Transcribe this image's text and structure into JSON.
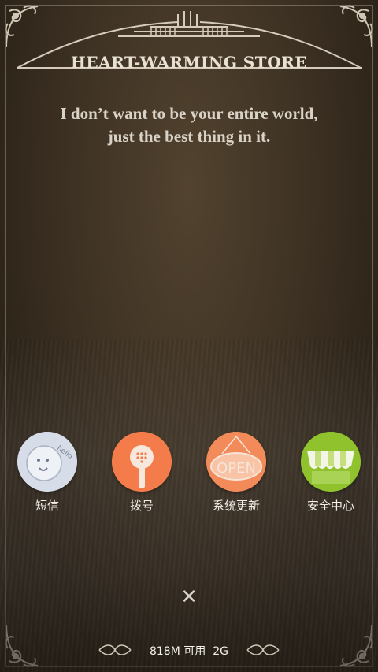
{
  "header": {
    "store_title": "HEART-WARMING STORE"
  },
  "quote": {
    "line1": "I don’t want to be your entire world,",
    "line2": "just the best thing in it."
  },
  "apps": [
    {
      "label": "短信",
      "icon": "sms-face-icon",
      "color": "#d6dde8"
    },
    {
      "label": "拨号",
      "icon": "phone-handset-icon",
      "color": "#f47c4a"
    },
    {
      "label": "系统更新",
      "icon": "open-sign-icon",
      "color": "#f28a5a"
    },
    {
      "label": "安全中心",
      "icon": "awning-shop-icon",
      "color": "#8fc22c"
    }
  ],
  "close": {
    "icon": "close-icon",
    "glyph": "✕"
  },
  "footer": {
    "memory": "818M 可用",
    "network": "2G"
  }
}
